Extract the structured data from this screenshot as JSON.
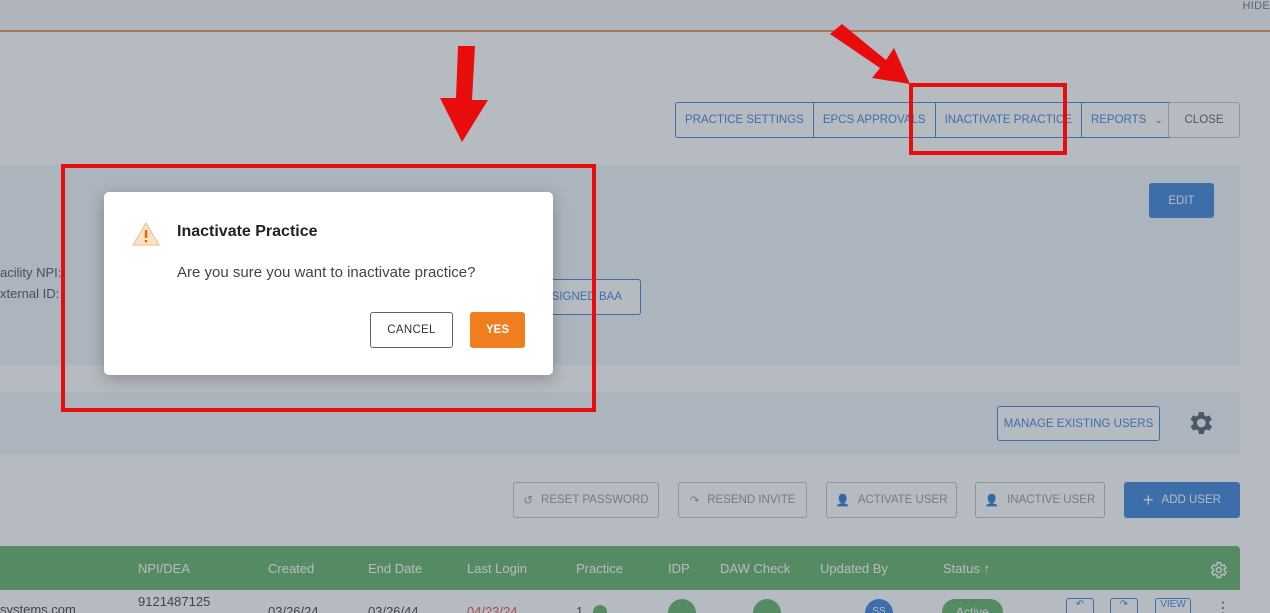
{
  "topbar": {
    "hide_label": "HIDE"
  },
  "practice_actions": {
    "practice_settings": "PRACTICE SETTINGS",
    "epcs_approvals": "EPCS APPROVALS",
    "inactivate_practice": "INACTIVATE PRACTICE",
    "reports": "REPORTS",
    "close": "CLOSE"
  },
  "details_panel": {
    "edit_label": "EDIT",
    "facility_npi_label": "acility NPI:",
    "external_id_label": "xternal ID:",
    "signed_baa_label": "SIGNED BAA"
  },
  "users_panel": {
    "manage_existing_users": "MANAGE EXISTING USERS",
    "reset_password": "RESET PASSWORD",
    "resend_invite": "RESEND INVITE",
    "activate_user": "ACTIVATE USER",
    "inactive_user": "INACTIVE USER",
    "add_user": "ADD USER"
  },
  "table": {
    "headers": [
      "NPI/DEA",
      "Created",
      "End Date",
      "Last Login",
      "Practice",
      "IDP",
      "DAW Check",
      "Updated By",
      "Status ↑"
    ],
    "row": {
      "email_fragment": "systems.com",
      "npi": "9121487125",
      "created": "03/26/24",
      "end_date": "03/26/44",
      "last_login": "04/23/24",
      "practice": "1",
      "updated_by": "SS",
      "status": "Active",
      "view": "VIEW"
    }
  },
  "modal": {
    "title": "Inactivate Practice",
    "message": "Are you sure you want to inactivate practice?",
    "cancel_label": "CANCEL",
    "yes_label": "YES"
  },
  "colors": {
    "annotation_red": "#e80c0c",
    "primary_blue": "#2f7ad6",
    "confirm_orange": "#f07d1e",
    "table_header_green": "#58ac5c"
  }
}
